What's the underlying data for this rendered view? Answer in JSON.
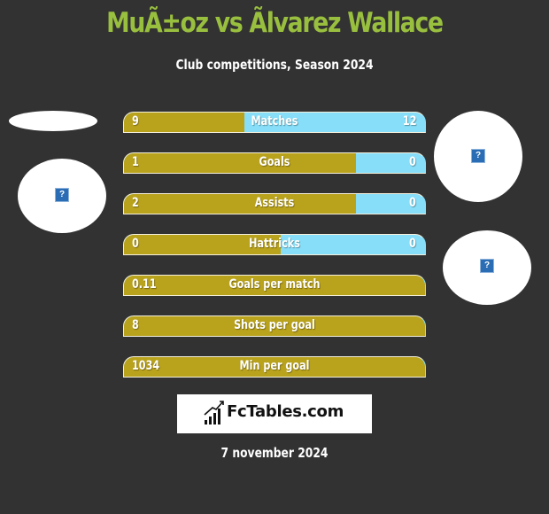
{
  "header": {
    "title": "MuÃ±oz vs Ãlvarez Wallace",
    "subtitle": "Club competitions, Season 2024"
  },
  "colors": {
    "left_player": "#b9a21c",
    "right_player": "#87def8",
    "title": "#99bf3f",
    "background": "#323232"
  },
  "player_images": {
    "left": {
      "icon": "broken-image-icon",
      "glyph": "?"
    },
    "right_top": {
      "icon": "broken-image-icon",
      "glyph": "?"
    },
    "right_bottom": {
      "icon": "broken-image-icon",
      "glyph": "?"
    }
  },
  "stats": [
    {
      "label": "Matches",
      "left": "9",
      "right": "12",
      "left_share": 0.4
    },
    {
      "label": "Goals",
      "left": "1",
      "right": "0",
      "left_share": 0.77
    },
    {
      "label": "Assists",
      "left": "2",
      "right": "0",
      "left_share": 0.77
    },
    {
      "label": "Hattricks",
      "left": "0",
      "right": "0",
      "left_share": 0.52
    },
    {
      "label": "Goals per match",
      "left": "0.11",
      "right": "",
      "left_share": 1.0
    },
    {
      "label": "Shots per goal",
      "left": "8",
      "right": "",
      "left_share": 1.0
    },
    {
      "label": "Min per goal",
      "left": "1034",
      "right": "",
      "left_share": 1.0
    }
  ],
  "footer": {
    "logo_text": "FcTables.com",
    "date": "7 november 2024"
  }
}
